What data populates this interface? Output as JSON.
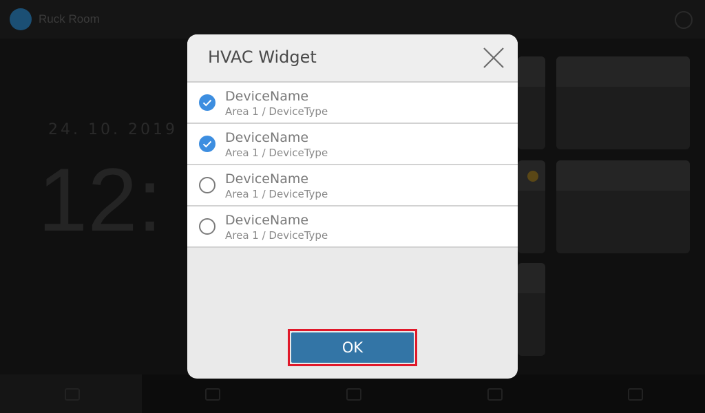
{
  "background": {
    "app_title": "Ruck Room",
    "date": "24. 10. 2019",
    "time": "12:"
  },
  "dialog": {
    "title": "HVAC Widget",
    "close_icon": "close-icon",
    "devices": [
      {
        "name": "DeviceName",
        "subtitle": "Area 1 / DeviceType",
        "checked": true
      },
      {
        "name": "DeviceName",
        "subtitle": "Area 1 / DeviceType",
        "checked": true
      },
      {
        "name": "DeviceName",
        "subtitle": "Area 1 / DeviceType",
        "checked": false
      },
      {
        "name": "DeviceName",
        "subtitle": "Area 1 / DeviceType",
        "checked": false
      }
    ],
    "ok_label": "OK"
  },
  "colors": {
    "accent": "#3375a6",
    "check_blue": "#3d8ee0",
    "highlight": "#e0192a"
  }
}
